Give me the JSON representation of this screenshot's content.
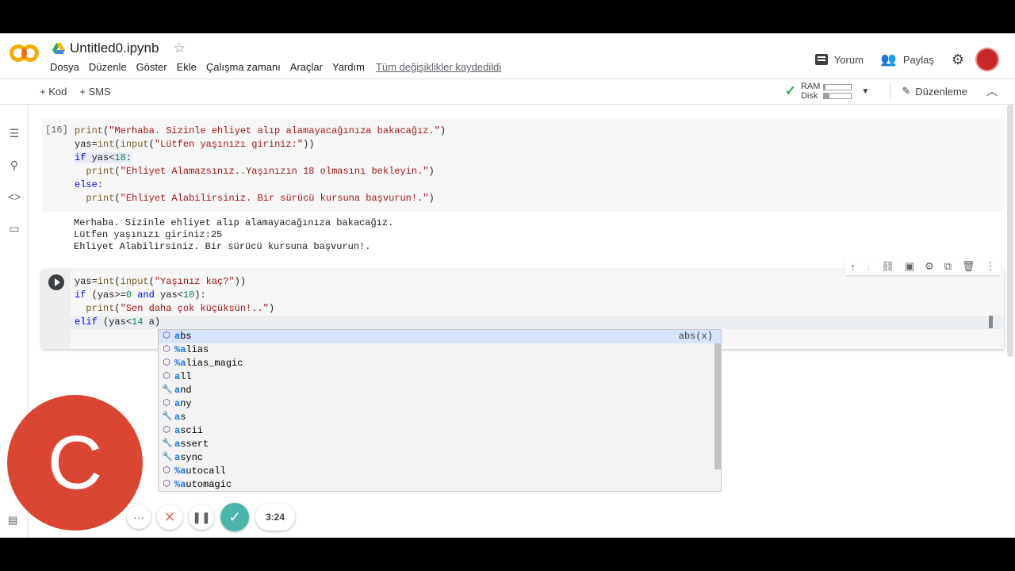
{
  "header": {
    "title": "Untitled0.ipynb",
    "menu": [
      "Dosya",
      "Düzenle",
      "Göster",
      "Ekle",
      "Çalışma zamanı",
      "Araçlar",
      "Yardım"
    ],
    "saved_status": "Tüm değişiklikler kaydedildi",
    "comment_label": "Yorum",
    "share_label": "Paylaş"
  },
  "toolbar": {
    "add_code": "+ Kod",
    "add_text": "+ SMS",
    "ram_label": "RAM",
    "disk_label": "Disk",
    "ram_usage": 0.05,
    "disk_usage": 0.2,
    "edit_label": "Düzenleme"
  },
  "cell1": {
    "exec_count": "[16]",
    "output": [
      "Merhaba. Sizinle ehliyet alıp alamayacağınıza bakacağız.",
      "Lütfen yaşınızı giriniz:25",
      "Ehliyet Alabilirsiniz. Bir sürücü kursuna başvurun!."
    ]
  },
  "autocomplete": {
    "detail": "abs(x)",
    "items": [
      {
        "prefix": "a",
        "rest": "bs",
        "icon": "cube-icon"
      },
      {
        "prefix": "%a",
        "rest": "lias",
        "icon": "cube-icon"
      },
      {
        "prefix": "%a",
        "rest": "lias_magic",
        "icon": "cube-icon"
      },
      {
        "prefix": "a",
        "rest": "ll",
        "icon": "cube-icon"
      },
      {
        "prefix": "a",
        "rest": "nd",
        "icon": "wrench-icon"
      },
      {
        "prefix": "a",
        "rest": "ny",
        "icon": "cube-icon"
      },
      {
        "prefix": "a",
        "rest": "s",
        "icon": "wrench-icon"
      },
      {
        "prefix": "a",
        "rest": "scii",
        "icon": "cube-icon"
      },
      {
        "prefix": "a",
        "rest": "ssert",
        "icon": "wrench-icon"
      },
      {
        "prefix": "a",
        "rest": "sync",
        "icon": "wrench-icon"
      },
      {
        "prefix": "%a",
        "rest": "utocall",
        "icon": "cube-icon"
      },
      {
        "prefix": "%a",
        "rest": "utomagic",
        "icon": "cube-icon"
      }
    ]
  },
  "recorder": {
    "letter": "C",
    "time": "3:24"
  },
  "colors": {
    "accent_orange": "#f9ab00",
    "keyword_blue": "#0000ff",
    "string_red": "#a31515",
    "recorder_red": "#db4633",
    "check_green": "#34a853"
  }
}
